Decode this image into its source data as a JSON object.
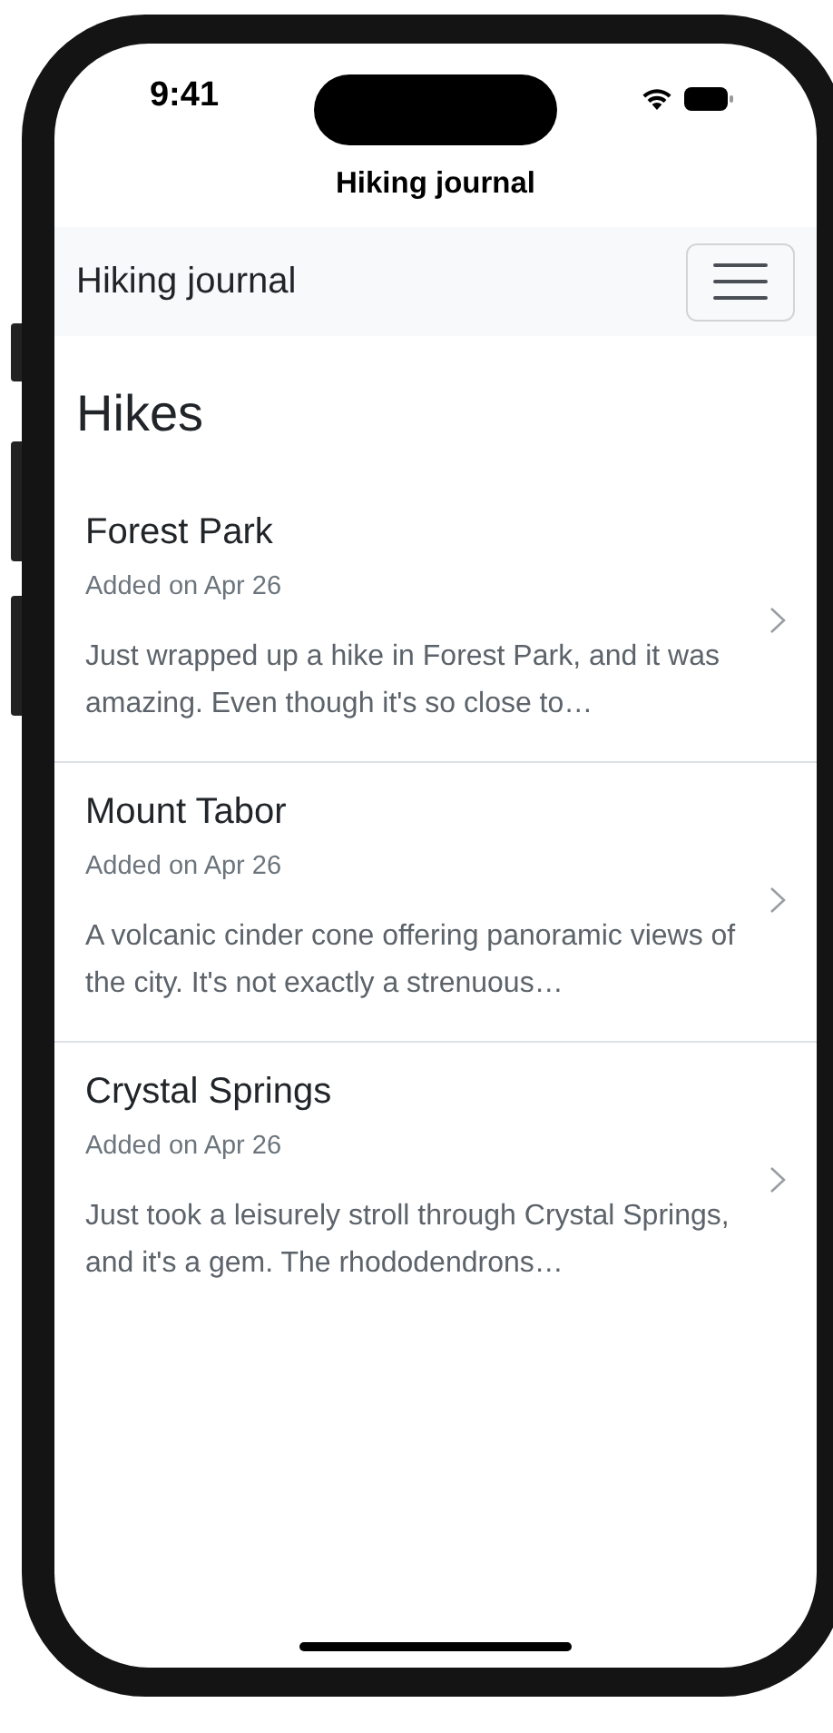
{
  "status_bar": {
    "time": "9:41"
  },
  "page_title": "Hiking journal",
  "navbar": {
    "brand": "Hiking journal"
  },
  "heading": "Hikes",
  "hikes": [
    {
      "name": "Forest Park",
      "added": "Added on Apr 26",
      "excerpt": "Just wrapped up a hike in Forest Park, and it was amazing. Even though it's so close to…"
    },
    {
      "name": "Mount Tabor",
      "added": "Added on Apr 26",
      "excerpt": "A volcanic cinder cone offering panoramic views of the city. It's not exactly a strenuous…"
    },
    {
      "name": "Crystal Springs",
      "added": "Added on Apr 26",
      "excerpt": "Just took a leisurely stroll through Crystal Springs, and it's a gem. The rhododendrons…"
    }
  ]
}
